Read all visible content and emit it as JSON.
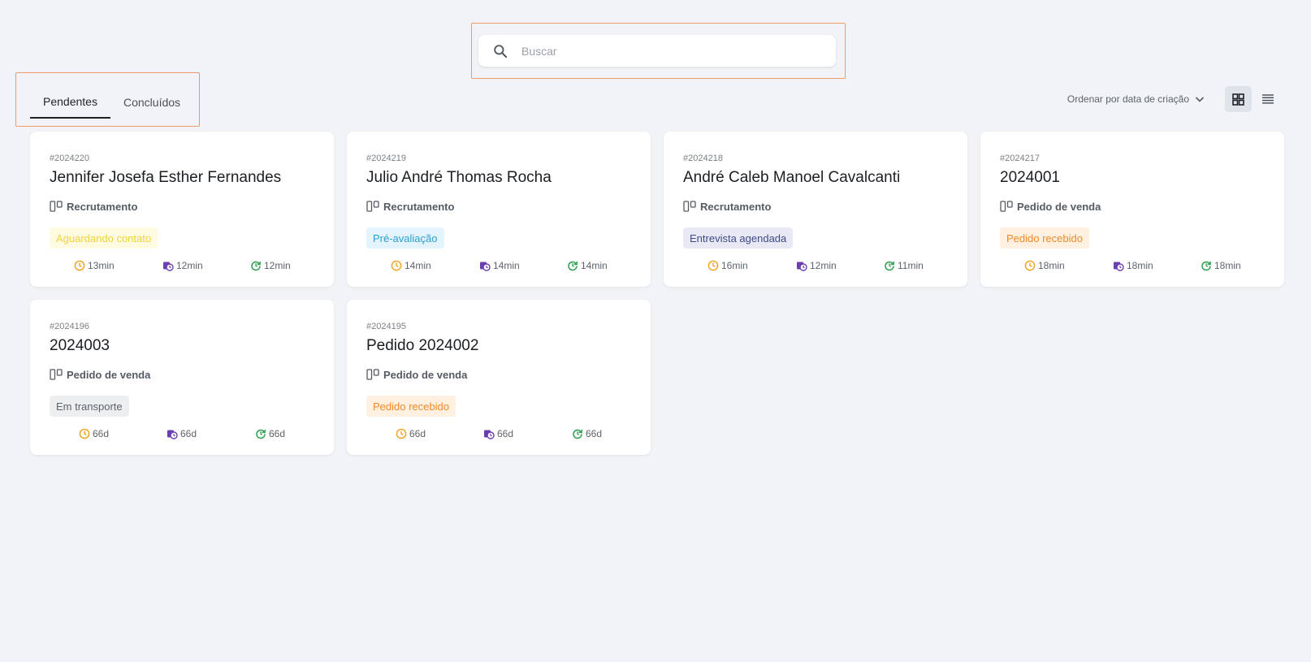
{
  "search": {
    "placeholder": "Buscar"
  },
  "tabs": [
    {
      "label": "Pendentes"
    },
    {
      "label": "Concluídos"
    }
  ],
  "sort": {
    "label": "Ordenar por data de criação"
  },
  "colors": {
    "clock": "#f0a020",
    "calendar": "#6b3fb0",
    "refresh": "#2e9e4f",
    "highlight": "#ef9a6c"
  },
  "cards": [
    {
      "code": "#2024220",
      "title": "Jennifer Josefa Esther Fernandes",
      "category": "Recrutamento",
      "badge": {
        "label": "Aguardando contato",
        "bg": "#fffbe0",
        "color": "#f0d23c"
      },
      "metrics": [
        "13min",
        "12min",
        "12min"
      ]
    },
    {
      "code": "#2024219",
      "title": "Julio André Thomas Rocha",
      "category": "Recrutamento",
      "badge": {
        "label": "Pré-avaliação",
        "bg": "#e3f4fd",
        "color": "#2d9fd1"
      },
      "metrics": [
        "14min",
        "14min",
        "14min"
      ]
    },
    {
      "code": "#2024218",
      "title": "André Caleb Manoel Cavalcanti",
      "category": "Recrutamento",
      "badge": {
        "label": "Entrevista agendada",
        "bg": "#e8e9f5",
        "color": "#3e4a8a"
      },
      "metrics": [
        "16min",
        "12min",
        "11min"
      ]
    },
    {
      "code": "#2024217",
      "title": "2024001",
      "category": "Pedido de venda",
      "badge": {
        "label": "Pedido recebido",
        "bg": "#fff0e0",
        "color": "#f08a2a"
      },
      "metrics": [
        "18min",
        "18min",
        "18min"
      ]
    },
    {
      "code": "#2024196",
      "title": "2024003",
      "category": "Pedido de venda",
      "badge": {
        "label": "Em transporte",
        "bg": "#eceef0",
        "color": "#5c636b"
      },
      "metrics": [
        "66d",
        "66d",
        "66d"
      ]
    },
    {
      "code": "#2024195",
      "title": "Pedido 2024002",
      "category": "Pedido de venda",
      "badge": {
        "label": "Pedido recebido",
        "bg": "#fff0e0",
        "color": "#f08a2a"
      },
      "metrics": [
        "66d",
        "66d",
        "66d"
      ]
    }
  ]
}
